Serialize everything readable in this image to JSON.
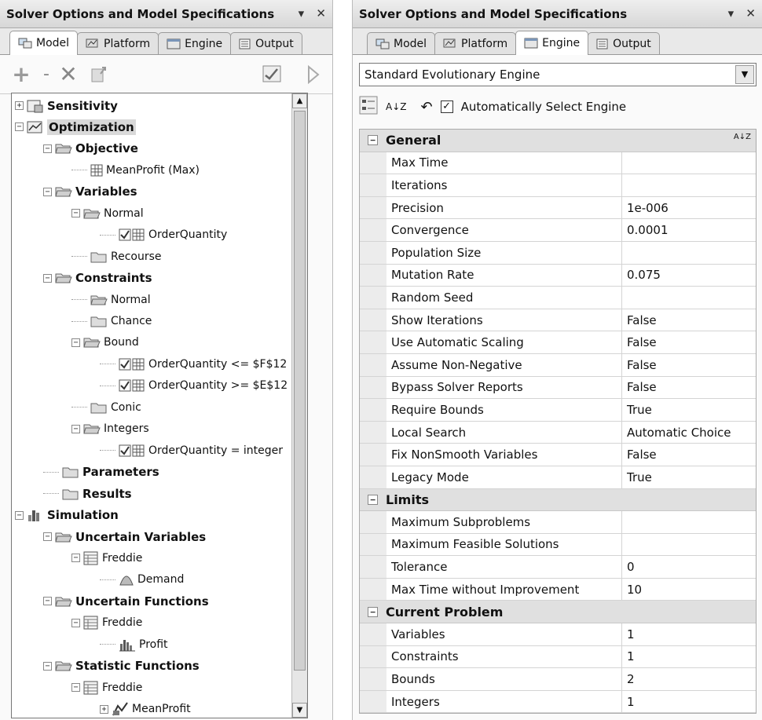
{
  "left": {
    "title": "Solver Options and Model Specifications",
    "controls": [
      "▾",
      "✕"
    ],
    "tabs": [
      "Model",
      "Platform",
      "Engine",
      "Output"
    ],
    "toolbar": [
      "+",
      "-",
      "✕"
    ],
    "tree": [
      {
        "label": "Sensitivity",
        "bold": true,
        "depth": 0,
        "icon": "sensitivity-icon",
        "exp": "+"
      },
      {
        "label": "Optimization",
        "bold": true,
        "depth": 0,
        "icon": "optimization-icon",
        "exp": "-",
        "selected": true
      },
      {
        "label": "Objective",
        "bold": true,
        "depth": 1,
        "icon": "folder-open-icon",
        "exp": "-"
      },
      {
        "label": "MeanProfit (Max)",
        "depth": 2,
        "icon": "cell-icon"
      },
      {
        "label": "Variables",
        "bold": true,
        "depth": 1,
        "icon": "folder-open-icon",
        "exp": "-"
      },
      {
        "label": "Normal",
        "depth": 2,
        "icon": "folder-open-icon",
        "exp": "-"
      },
      {
        "label": "OrderQuantity",
        "depth": 3,
        "icon": "checked-cell-icon"
      },
      {
        "label": "Recourse",
        "depth": 2,
        "icon": "folder-icon"
      },
      {
        "label": "Constraints",
        "bold": true,
        "depth": 1,
        "icon": "folder-open-icon",
        "exp": "-"
      },
      {
        "label": "Normal",
        "depth": 2,
        "icon": "folder-open-icon"
      },
      {
        "label": "Chance",
        "depth": 2,
        "icon": "folder-icon"
      },
      {
        "label": "Bound",
        "depth": 2,
        "icon": "folder-open-icon",
        "exp": "-"
      },
      {
        "label": "OrderQuantity <= $F$12",
        "depth": 3,
        "icon": "checked-cell-icon"
      },
      {
        "label": "OrderQuantity >= $E$12",
        "depth": 3,
        "icon": "checked-cell-icon"
      },
      {
        "label": "Conic",
        "depth": 2,
        "icon": "folder-icon"
      },
      {
        "label": "Integers",
        "depth": 2,
        "icon": "folder-open-icon",
        "exp": "-"
      },
      {
        "label": "OrderQuantity = integer",
        "depth": 3,
        "icon": "checked-cell-icon"
      },
      {
        "label": "Parameters",
        "bold": true,
        "depth": 1,
        "icon": "folder-icon"
      },
      {
        "label": "Results",
        "bold": true,
        "depth": 1,
        "icon": "folder-icon"
      },
      {
        "label": "Simulation",
        "bold": true,
        "depth": 0,
        "icon": "simulation-icon",
        "exp": "-"
      },
      {
        "label": "Uncertain Variables",
        "bold": true,
        "depth": 1,
        "icon": "folder-open-icon",
        "exp": "-"
      },
      {
        "label": "Freddie",
        "depth": 2,
        "icon": "worksheet-icon",
        "exp": "-"
      },
      {
        "label": "Demand",
        "depth": 3,
        "icon": "distribution-icon"
      },
      {
        "label": "Uncertain Functions",
        "bold": true,
        "depth": 1,
        "icon": "folder-open-icon",
        "exp": "-"
      },
      {
        "label": "Freddie",
        "depth": 2,
        "icon": "worksheet-icon",
        "exp": "-"
      },
      {
        "label": "Profit",
        "depth": 3,
        "icon": "histogram-icon"
      },
      {
        "label": "Statistic Functions",
        "bold": true,
        "depth": 1,
        "icon": "folder-open-icon",
        "exp": "-"
      },
      {
        "label": "Freddie",
        "depth": 2,
        "icon": "worksheet-icon",
        "exp": "-"
      },
      {
        "label": "MeanProfit",
        "depth": 3,
        "icon": "statistic-icon",
        "exp": "+"
      }
    ]
  },
  "right": {
    "title": "Solver Options and Model Specifications",
    "controls": [
      "▾",
      "✕"
    ],
    "tabs": [
      "Model",
      "Platform",
      "Engine",
      "Output"
    ],
    "engine": "Standard Evolutionary Engine",
    "auto_select_label": "Automatically Select Engine",
    "sort_label": "A↓Z",
    "grid": [
      {
        "category": "General"
      },
      {
        "name": "Max Time",
        "value": ""
      },
      {
        "name": "Iterations",
        "value": ""
      },
      {
        "name": "Precision",
        "value": "1e-006"
      },
      {
        "name": "Convergence",
        "value": "0.0001"
      },
      {
        "name": "Population Size",
        "value": ""
      },
      {
        "name": "Mutation Rate",
        "value": "0.075"
      },
      {
        "name": "Random Seed",
        "value": ""
      },
      {
        "name": "Show Iterations",
        "value": "False"
      },
      {
        "name": "Use Automatic Scaling",
        "value": "False"
      },
      {
        "name": "Assume Non-Negative",
        "value": "False"
      },
      {
        "name": "Bypass Solver Reports",
        "value": "False"
      },
      {
        "name": "Require Bounds",
        "value": "True"
      },
      {
        "name": "Local Search",
        "value": "Automatic Choice"
      },
      {
        "name": "Fix NonSmooth Variables",
        "value": "False"
      },
      {
        "name": "Legacy Mode",
        "value": "True"
      },
      {
        "category": "Limits"
      },
      {
        "name": "Maximum Subproblems",
        "value": ""
      },
      {
        "name": "Maximum Feasible Solutions",
        "value": ""
      },
      {
        "name": "Tolerance",
        "value": "0"
      },
      {
        "name": "Max Time without Improvement",
        "value": "10"
      },
      {
        "category": "Current Problem"
      },
      {
        "name": "Variables",
        "value": "1"
      },
      {
        "name": "Constraints",
        "value": "1"
      },
      {
        "name": "Bounds",
        "value": "2"
      },
      {
        "name": "Integers",
        "value": "1"
      }
    ]
  }
}
